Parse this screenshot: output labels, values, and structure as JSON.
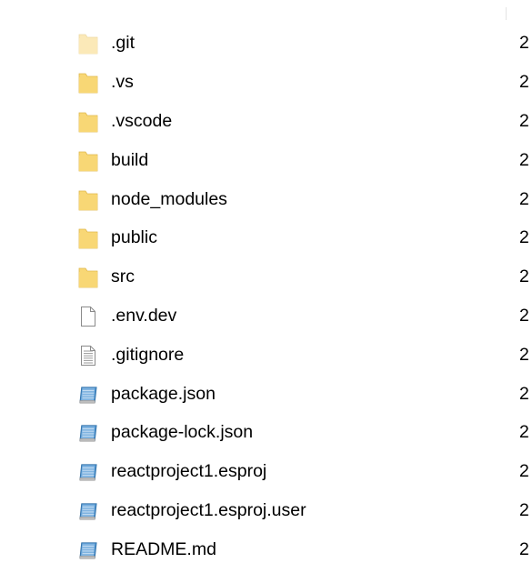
{
  "colors": {
    "folder": "#f8d775",
    "folder_light": "#fbe7b1",
    "folder_edge": "#e0b94f",
    "doc_outline": "#8a8a8a",
    "code_file": "#4a8ec9"
  },
  "files": [
    {
      "name": ".git",
      "icon": "folder-hidden-icon",
      "date": "2"
    },
    {
      "name": ".vs",
      "icon": "folder-icon",
      "date": "2"
    },
    {
      "name": ".vscode",
      "icon": "folder-icon",
      "date": "2"
    },
    {
      "name": "build",
      "icon": "folder-icon",
      "date": "2"
    },
    {
      "name": "node_modules",
      "icon": "folder-icon",
      "date": "2"
    },
    {
      "name": "public",
      "icon": "folder-icon",
      "date": "2"
    },
    {
      "name": "src",
      "icon": "folder-icon",
      "date": "2"
    },
    {
      "name": ".env.dev",
      "icon": "blank-file-icon",
      "date": "2"
    },
    {
      "name": ".gitignore",
      "icon": "text-file-icon",
      "date": "2"
    },
    {
      "name": "package.json",
      "icon": "code-file-icon",
      "date": "2"
    },
    {
      "name": "package-lock.json",
      "icon": "code-file-icon",
      "date": "2"
    },
    {
      "name": "reactproject1.esproj",
      "icon": "code-file-icon",
      "date": "2"
    },
    {
      "name": "reactproject1.esproj.user",
      "icon": "code-file-icon",
      "date": "2"
    },
    {
      "name": "README.md",
      "icon": "code-file-icon",
      "date": "2"
    }
  ]
}
